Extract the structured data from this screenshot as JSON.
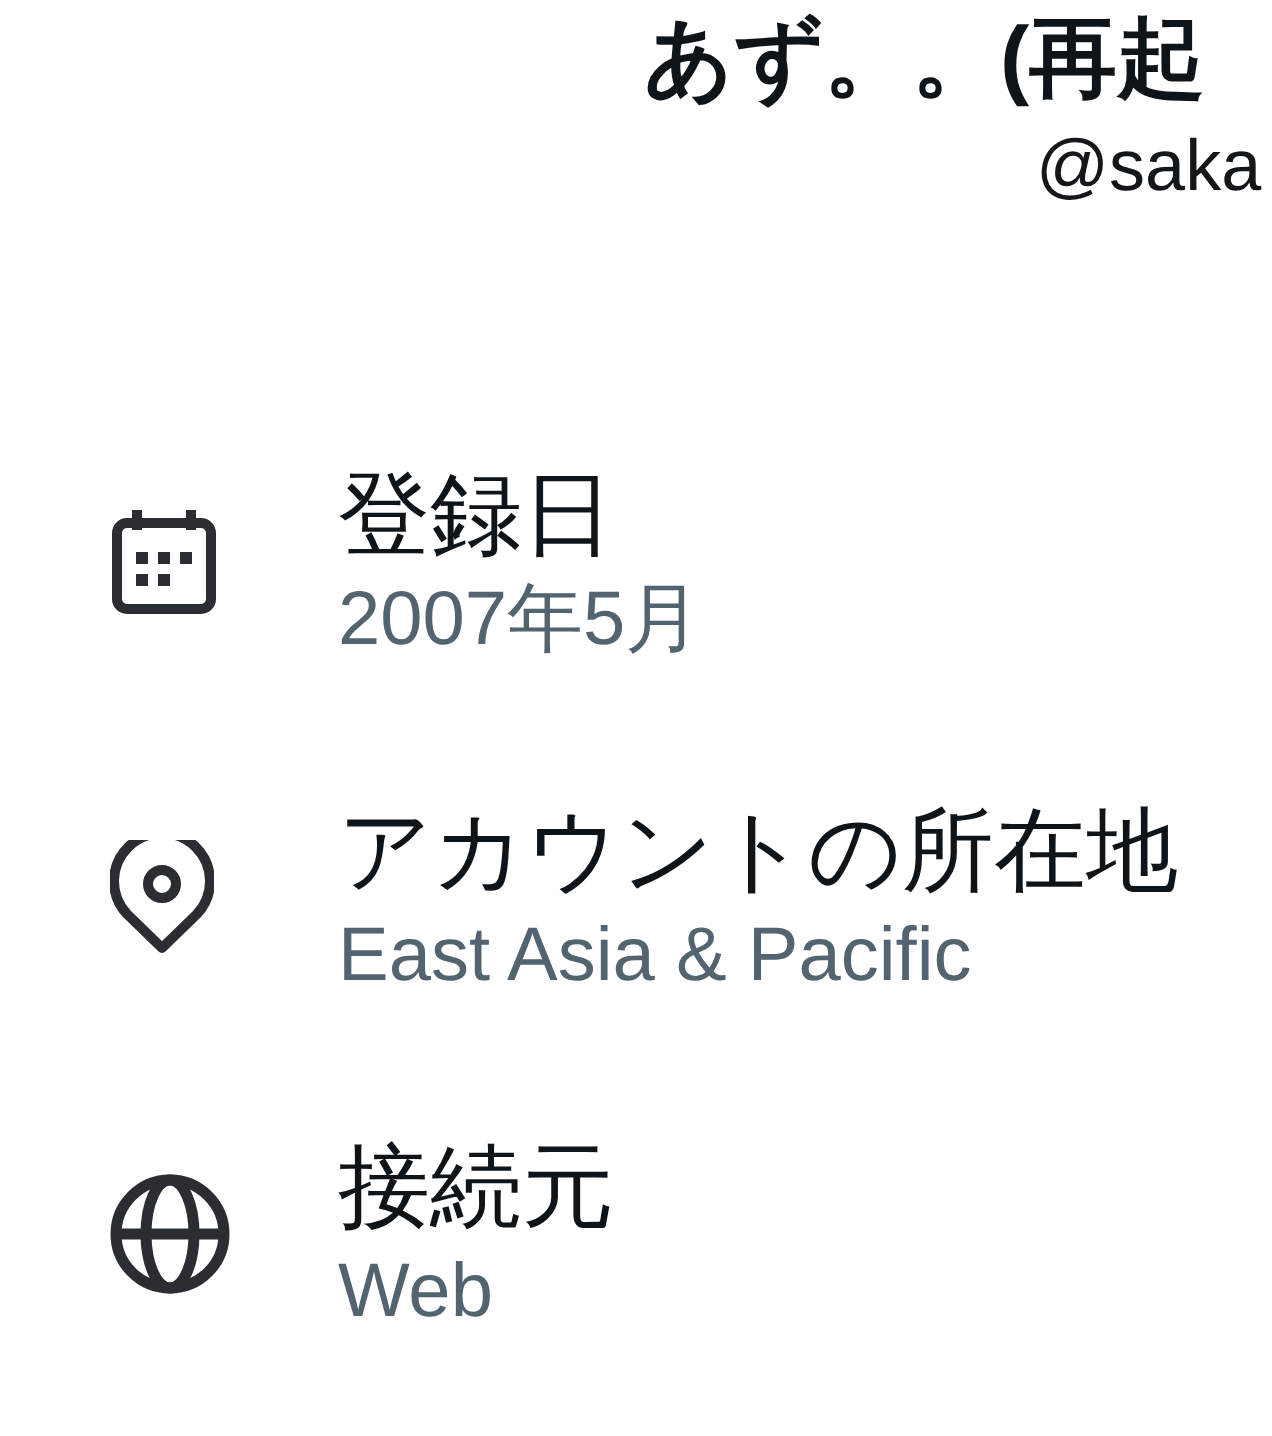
{
  "profile": {
    "display_name": "あず。。(再起",
    "handle": "@saka"
  },
  "details": [
    {
      "kind": "calendar",
      "label": "登録日",
      "value": "2007年5月"
    },
    {
      "kind": "location",
      "label": "アカウントの所在地",
      "value": "East Asia & Pacific"
    },
    {
      "kind": "globe",
      "label": "接続元",
      "value": "Web"
    }
  ]
}
